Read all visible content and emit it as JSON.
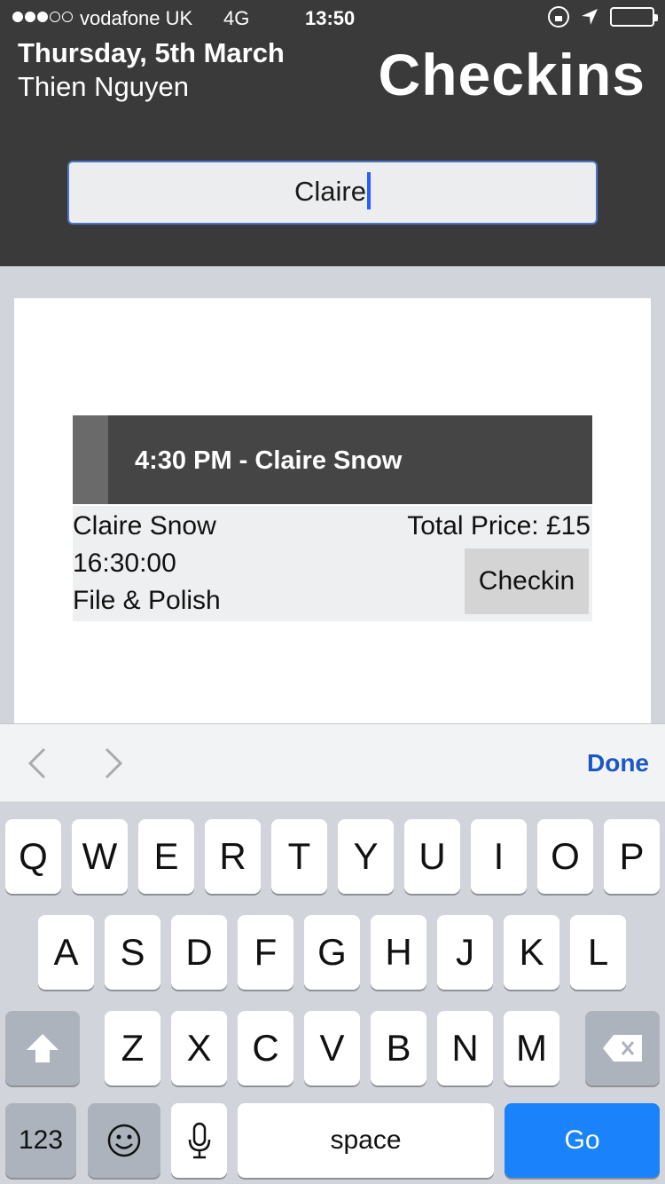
{
  "status_bar": {
    "carrier": "vodafone UK",
    "network": "4G",
    "time": "13:50"
  },
  "header": {
    "date": "Thursday, 5th March",
    "user": "Thien Nguyen",
    "title": "Checkins"
  },
  "search": {
    "value": "Claire"
  },
  "booking": {
    "heading": "4:30 PM - Claire Snow",
    "client_name": "Claire Snow",
    "time": "16:30:00",
    "service": "File & Polish",
    "total_price": "Total Price: £15",
    "checkin_label": "Checkin"
  },
  "accessory_bar": {
    "done_label": "Done"
  },
  "keyboard": {
    "row1": [
      "Q",
      "W",
      "E",
      "R",
      "T",
      "Y",
      "U",
      "I",
      "O",
      "P"
    ],
    "row2": [
      "A",
      "S",
      "D",
      "F",
      "G",
      "H",
      "J",
      "K",
      "L"
    ],
    "row3": [
      "Z",
      "X",
      "C",
      "V",
      "B",
      "N",
      "M"
    ],
    "numbers_label": "123",
    "space_label": "space",
    "go_label": "Go"
  },
  "colors": {
    "header_bg": "#3a3a3a",
    "accent_blue": "#1a56c4",
    "go_blue": "#1a82fb",
    "caret": "#2b5cff"
  }
}
